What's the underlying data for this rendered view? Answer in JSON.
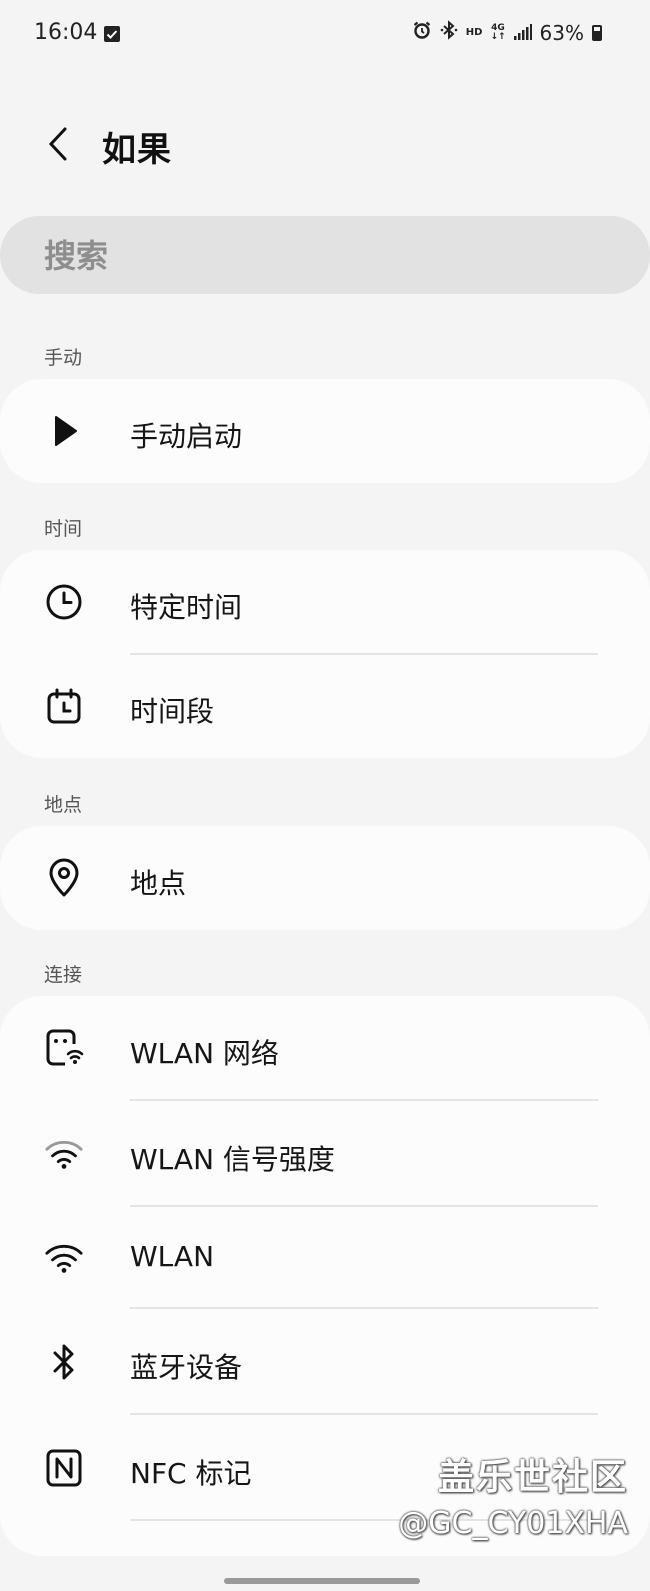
{
  "status_bar": {
    "time": "16:04",
    "icons": [
      "checkbox-notification-icon",
      "alarm-icon",
      "bluetooth-icon",
      "hd-icon",
      "4g-icon",
      "signal-icon"
    ],
    "hd": "HD",
    "network": "4G",
    "battery": "63%"
  },
  "header": {
    "back_icon": "chevron-left-icon",
    "title": "如果"
  },
  "search": {
    "placeholder": "搜索"
  },
  "sections": [
    {
      "label": "手动",
      "items": [
        {
          "label": "手动启动",
          "icon": "play-icon"
        }
      ]
    },
    {
      "label": "时间",
      "items": [
        {
          "label": "特定时间",
          "icon": "clock-icon"
        },
        {
          "label": "时间段",
          "icon": "calendar-clock-icon"
        }
      ]
    },
    {
      "label": "地点",
      "items": [
        {
          "label": "地点",
          "icon": "location-pin-icon"
        }
      ]
    },
    {
      "label": "连接",
      "items": [
        {
          "label": "WLAN 网络",
          "icon": "wlan-network-icon"
        },
        {
          "label": "WLAN 信号强度",
          "icon": "wifi-strength-icon"
        },
        {
          "label": "WLAN",
          "icon": "wifi-icon"
        },
        {
          "label": "蓝牙设备",
          "icon": "bluetooth-icon"
        },
        {
          "label": "NFC 标记",
          "icon": "nfc-icon"
        }
      ]
    }
  ],
  "watermark": {
    "line1": "盖乐世社区",
    "line2": "@GC_CY01XHA"
  },
  "colors": {
    "background": "#f4f4f4",
    "card": "#fcfcfc",
    "search_bg": "#e2e2e2"
  }
}
